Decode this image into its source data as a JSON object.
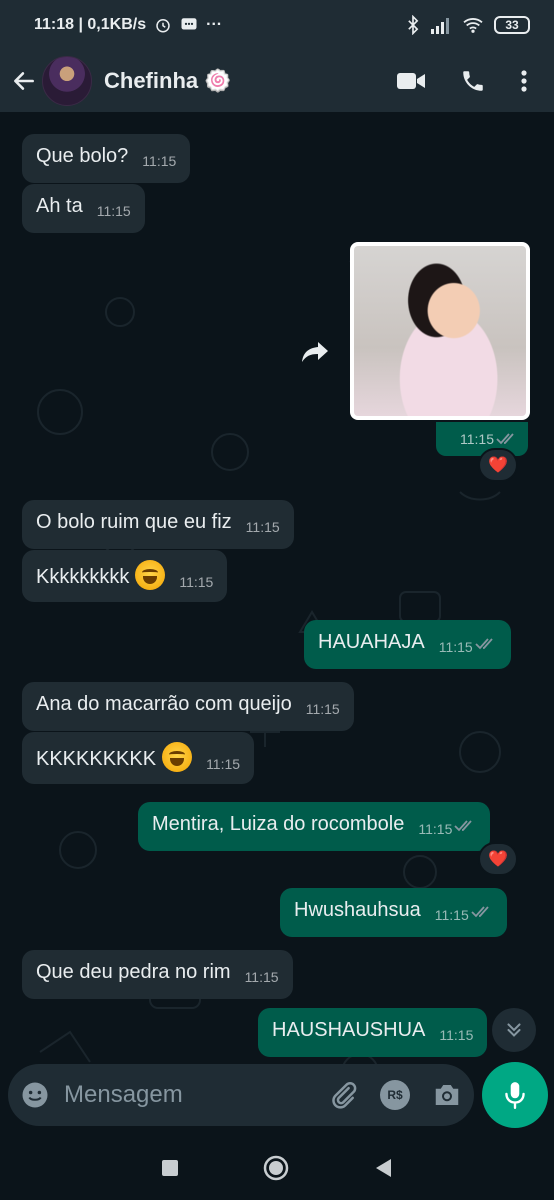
{
  "status_bar": {
    "time_speed": "11:18 | 0,1KB/s",
    "more": "···",
    "battery": "33"
  },
  "header": {
    "contact_name": "Chefinha",
    "name_emoji": "🍥"
  },
  "messages": [
    {
      "text": "Que bolo?",
      "time": "11:15"
    },
    {
      "text": "Ah ta",
      "time": "11:15"
    },
    {
      "image_time": "11:15",
      "reaction": "❤️"
    },
    {
      "text": "O bolo ruim que eu fiz",
      "time": "11:15"
    },
    {
      "text": "Kkkkkkkkk",
      "time": "11:15"
    },
    {
      "text": "HAUAHAJA",
      "time": "11:15"
    },
    {
      "text": "Ana do macarrão com queijo",
      "time": "11:15"
    },
    {
      "text": "KKKKKKKKK",
      "time": "11:15"
    },
    {
      "text": "Mentira, Luiza do rocombole",
      "time": "11:15",
      "reaction": "❤️"
    },
    {
      "text": "Hwushauhsua",
      "time": "11:15"
    },
    {
      "text": "Que deu pedra no rim",
      "time": "11:15"
    },
    {
      "text": "HAUSHAUSHUA",
      "time": "11:15"
    }
  ],
  "composer": {
    "placeholder": "Mensagem",
    "currency_label": "R$"
  },
  "colors": {
    "incoming_bubble": "#202c33",
    "outgoing_bubble": "#005c4b",
    "accent": "#00a884",
    "read_ticks": "#53bdeb"
  },
  "icons": [
    "back-arrow-icon",
    "video-call-icon",
    "phone-icon",
    "more-vert-icon",
    "forward-icon",
    "emoji-icon",
    "attach-icon",
    "payment-icon",
    "camera-icon",
    "mic-icon",
    "scroll-down-icon"
  ]
}
